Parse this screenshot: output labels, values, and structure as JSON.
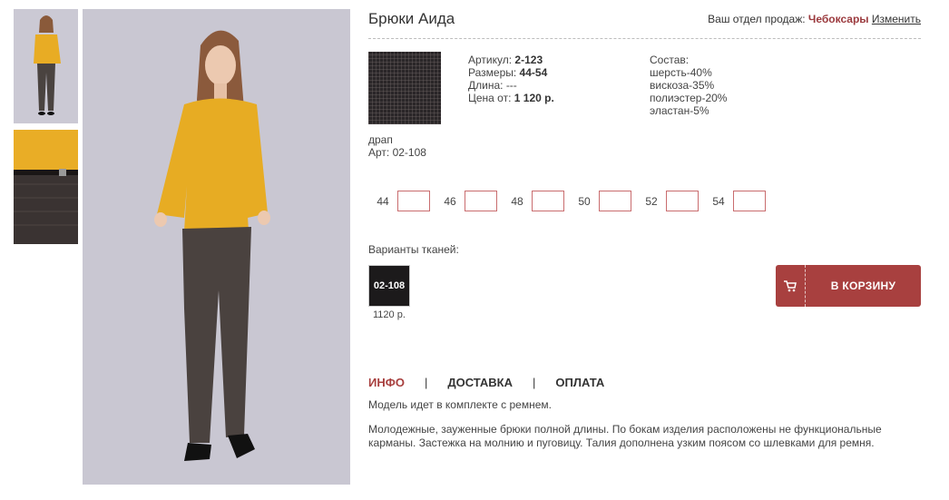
{
  "product": {
    "title": "Брюки Аида",
    "article_label": "Артикул:",
    "article": "2-123",
    "sizes_label": "Размеры:",
    "sizes": "44-54",
    "length_label": "Длина:",
    "length": "---",
    "price_label": "Цена от:",
    "price": "1 120 р."
  },
  "region": {
    "label": "Ваш отдел продаж:",
    "city": "Чебоксары",
    "change": "Изменить"
  },
  "composition": {
    "title": "Состав:",
    "items": [
      "шерсть-40%",
      "вискоза-35%",
      "полиэстер-20%",
      "эластан-5%"
    ]
  },
  "fabric": {
    "name": "драп",
    "code": "Арт: 02-108"
  },
  "size_options": [
    "44",
    "46",
    "48",
    "50",
    "52",
    "54"
  ],
  "variants": {
    "label": "Варианты тканей:",
    "items": [
      {
        "code": "02-108",
        "price": "1120 р."
      }
    ]
  },
  "cart": {
    "label": "В КОРЗИНУ",
    "icon": "cart-icon",
    "color": "#a8403f"
  },
  "tabs": [
    {
      "label": "ИНФО",
      "active": true
    },
    {
      "label": "ДОСТАВКА",
      "active": false
    },
    {
      "label": "ОПЛАТА",
      "active": false
    }
  ],
  "tab_separator": "|",
  "info": {
    "line1": "Модель идет в комплекте с ремнем.",
    "line2": "Молодежные, зауженные брюки полной длины. По бокам изделия расположены не функциональные карманы. Застежка на молнию и пуговицу. Талия дополнена узким поясом со шлевками для ремня."
  }
}
